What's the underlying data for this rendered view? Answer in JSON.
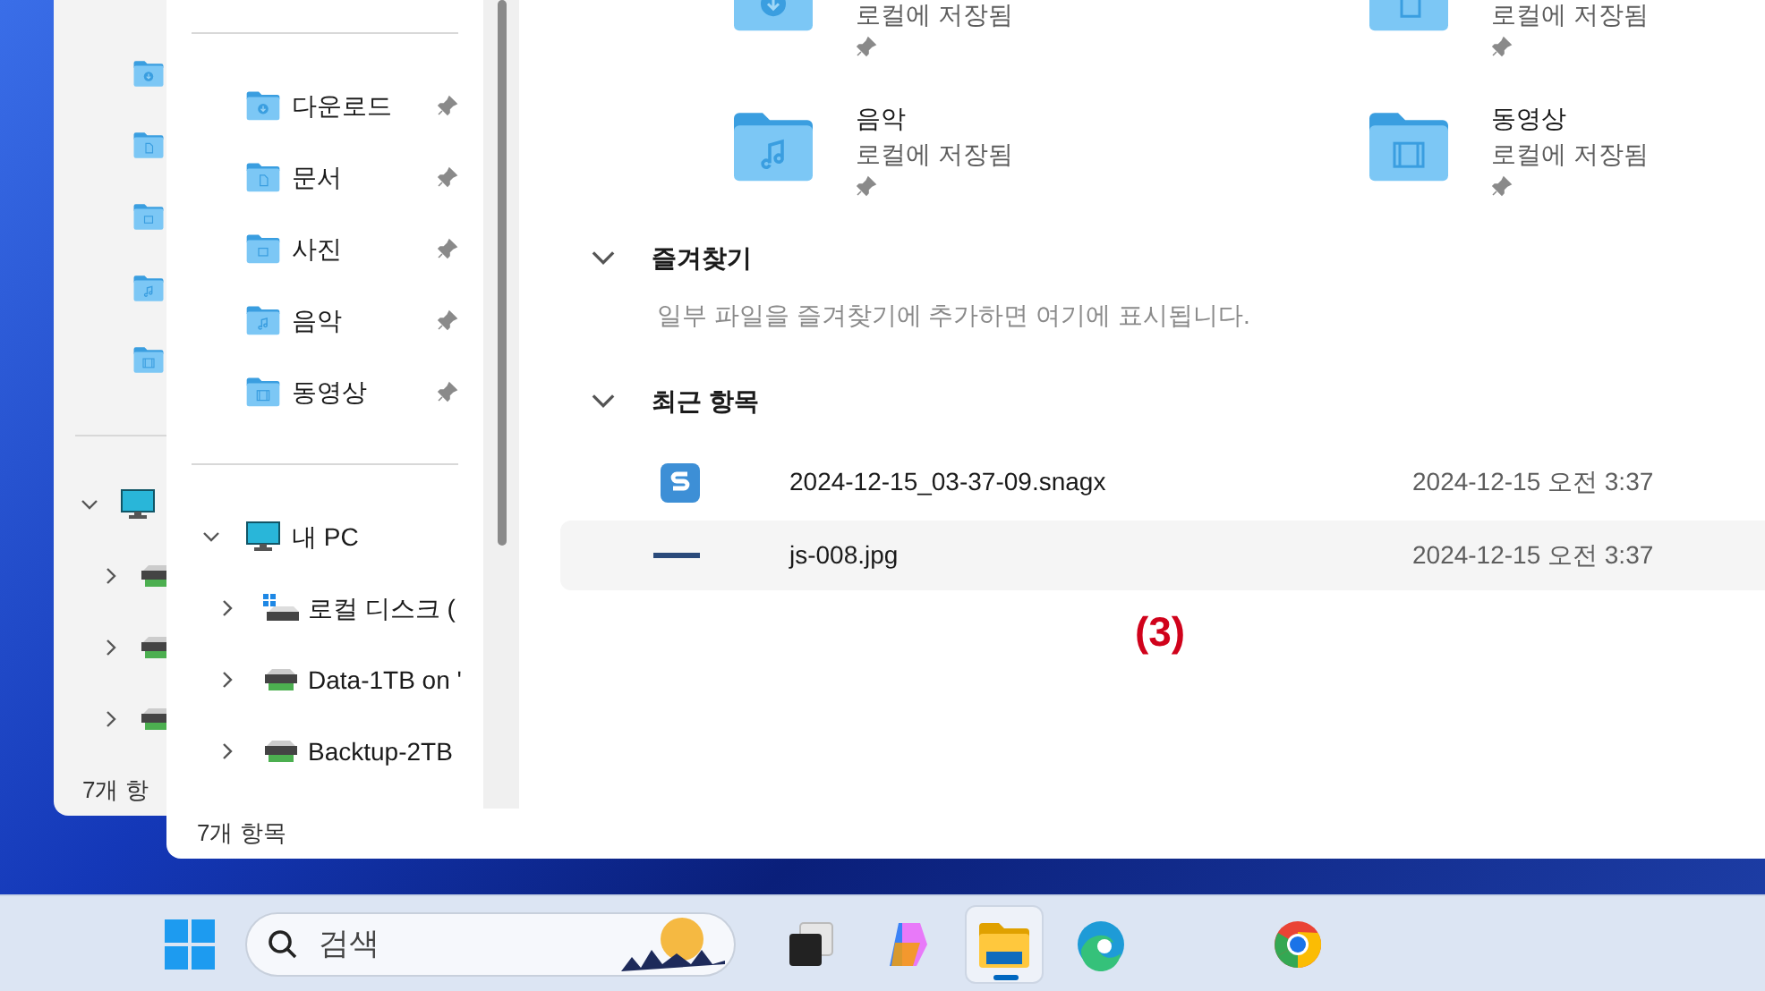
{
  "back_window": {
    "nav": {
      "expanded": true,
      "children": [
        {
          "expanded": false
        },
        {
          "expanded": false
        },
        {
          "expanded": false
        }
      ]
    },
    "status_bar": "7개 항"
  },
  "sidebar": {
    "quick_access": [
      {
        "label": "다운로드",
        "kind": "downloads",
        "pinned": true
      },
      {
        "label": "문서",
        "kind": "documents",
        "pinned": true
      },
      {
        "label": "사진",
        "kind": "pictures",
        "pinned": true
      },
      {
        "label": "음악",
        "kind": "music",
        "pinned": true
      },
      {
        "label": "동영상",
        "kind": "videos",
        "pinned": true
      }
    ],
    "this_pc": {
      "label": "내 PC",
      "expanded": true,
      "children": [
        {
          "label": "로컬 디스크 (",
          "kind": "system-drive",
          "expanded": false
        },
        {
          "label": "Data-1TB on '",
          "kind": "network-drive",
          "expanded": false
        },
        {
          "label": "Backtup-2TB",
          "kind": "network-drive",
          "expanded": false
        }
      ]
    }
  },
  "tiles": [
    {
      "subtitle": "로컬에 저장됨",
      "kind": "downloads",
      "pinned": true
    },
    {
      "subtitle": "로컬에 저장됨",
      "kind": "documents",
      "pinned": true
    },
    {
      "name": "음악",
      "subtitle": "로컬에 저장됨",
      "kind": "music",
      "pinned": true
    },
    {
      "name": "동영상",
      "subtitle": "로컬에 저장됨",
      "kind": "videos",
      "pinned": true
    }
  ],
  "sections": [
    {
      "title": "즐겨찾기",
      "expanded": true,
      "message": "일부 파일을 즐겨찾기에 추가하면 여기에 표시됩니다."
    },
    {
      "title": "최근 항목",
      "expanded": true,
      "files": [
        {
          "name": "2024-12-15_03-37-09.snagx",
          "date": "2024-12-15 오전 3:37",
          "kind": "snagit",
          "selected": false
        },
        {
          "name": "js-008.jpg",
          "date": "2024-12-15 오전 3:37",
          "kind": "image",
          "selected": true
        }
      ]
    }
  ],
  "annotation": "(3)",
  "status_bar": "7개 항목",
  "taskbar": {
    "search": {
      "placeholder": "검색"
    },
    "apps": [
      {
        "kind": "task-view",
        "selected": false
      },
      {
        "kind": "copilot",
        "selected": false
      },
      {
        "kind": "explorer",
        "selected": true
      },
      {
        "kind": "edge",
        "selected": false
      },
      {
        "kind": "chrome",
        "selected": false
      }
    ]
  }
}
